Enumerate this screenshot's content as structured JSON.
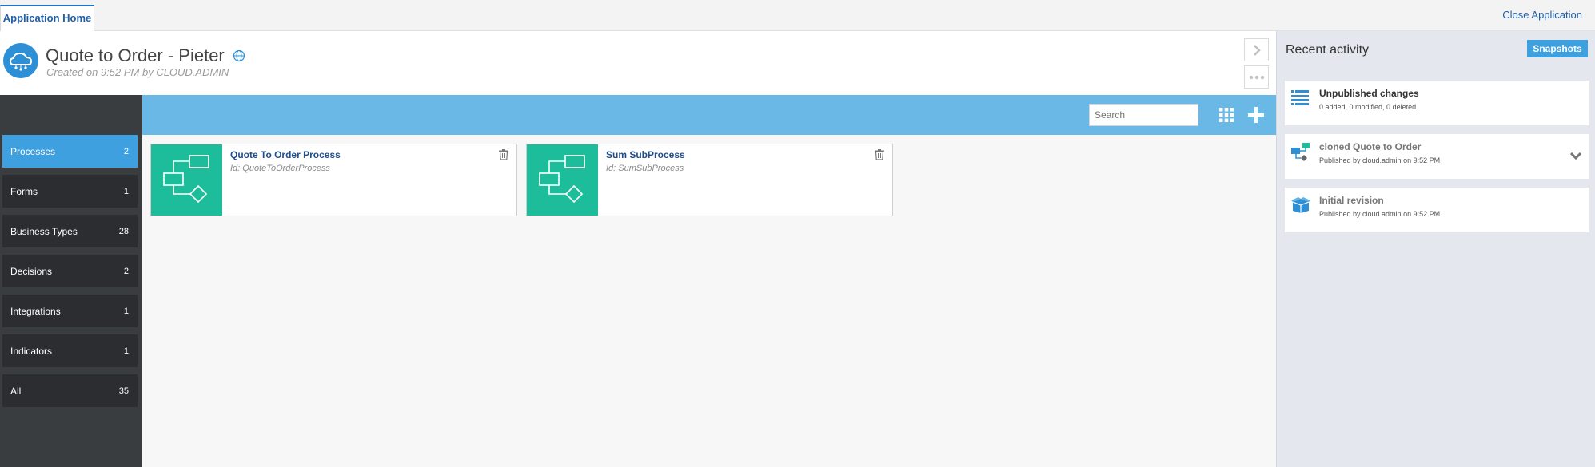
{
  "tabs": {
    "home": "Application Home",
    "close": "Close Application"
  },
  "header": {
    "title": "Quote to Order - Pieter",
    "subtitle": "Created on 9:52 PM by CLOUD.ADMIN"
  },
  "nav": [
    {
      "label": "Processes",
      "count": "2",
      "active": true
    },
    {
      "label": "Forms",
      "count": "1"
    },
    {
      "label": "Business Types",
      "count": "28"
    },
    {
      "label": "Decisions",
      "count": "2"
    },
    {
      "label": "Integrations",
      "count": "1"
    },
    {
      "label": "Indicators",
      "count": "1"
    },
    {
      "label": "All",
      "count": "35"
    }
  ],
  "search": {
    "placeholder": "Search"
  },
  "cards": [
    {
      "title": "Quote To Order Process",
      "id": "Id: QuoteToOrderProcess"
    },
    {
      "title": "Sum SubProcess",
      "id": "Id: SumSubProcess"
    }
  ],
  "recent": {
    "title": "Recent activity",
    "snapshots": "Snapshots",
    "items": [
      {
        "title": "Unpublished changes",
        "desc": "0 added, 0 modified, 0 deleted.",
        "icon": "list-icon"
      },
      {
        "title": "cloned Quote to Order",
        "desc": "Published by cloud.admin on 9:52 PM.",
        "icon": "clone-icon"
      },
      {
        "title": "Initial revision",
        "desc": "Published by cloud.admin on 9:52 PM.",
        "icon": "box-icon"
      }
    ]
  },
  "colors": {
    "accent": "#3fa0e0",
    "toolbar": "#69b8e6",
    "thumb": "#1dbd9b",
    "nav_bg": "#2b2d30"
  }
}
